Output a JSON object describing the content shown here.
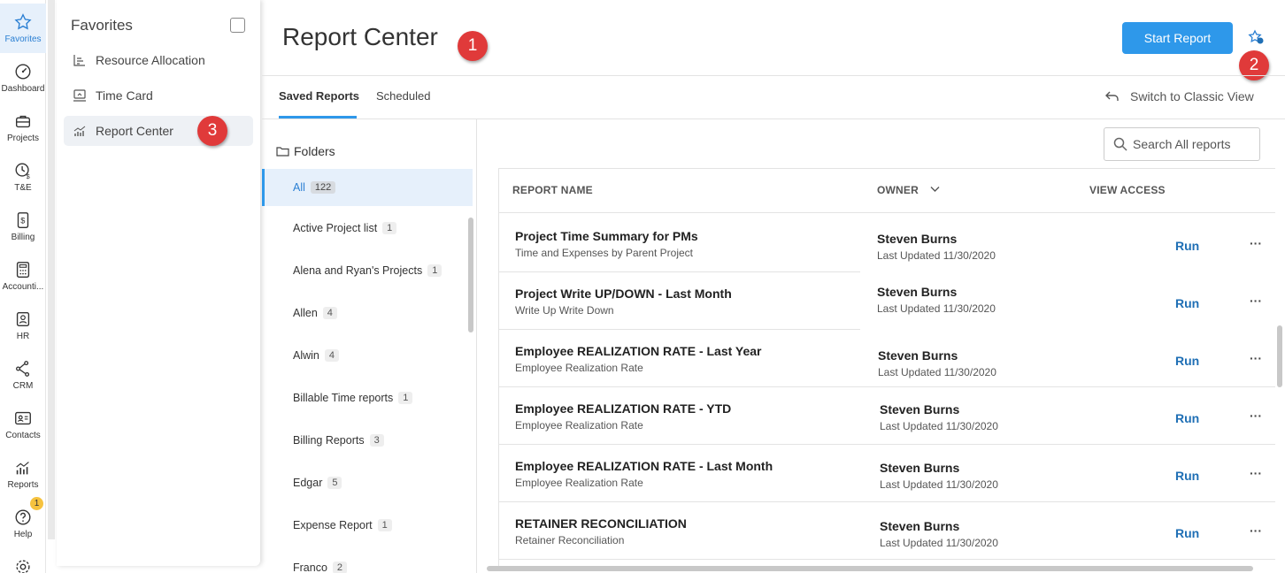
{
  "rail": {
    "items": [
      {
        "label": "Favorites",
        "icon": "star-icon"
      },
      {
        "label": "Dashboard",
        "icon": "dashboard-icon"
      },
      {
        "label": "Projects",
        "icon": "briefcase-icon"
      },
      {
        "label": "T&E",
        "icon": "clock-dollar-icon"
      },
      {
        "label": "Billing",
        "icon": "invoice-dollar-icon"
      },
      {
        "label": "Accounti...",
        "icon": "calculator-icon"
      },
      {
        "label": "HR",
        "icon": "person-badge-icon"
      },
      {
        "label": "CRM",
        "icon": "network-icon"
      },
      {
        "label": "Contacts",
        "icon": "contact-card-icon"
      },
      {
        "label": "Reports",
        "icon": "bar-chart-icon"
      },
      {
        "label": "Help",
        "icon": "help-circle-icon"
      }
    ],
    "help_badge": "1"
  },
  "favorites": {
    "title": "Favorites",
    "items": [
      {
        "label": "Resource Allocation"
      },
      {
        "label": "Time Card"
      },
      {
        "label": "Report Center"
      }
    ]
  },
  "callouts": [
    "1",
    "2",
    "3"
  ],
  "header": {
    "title": "Report Center",
    "start_button": "Start Report"
  },
  "tabs": [
    "Saved Reports",
    "Scheduled"
  ],
  "switch_view": "Switch to Classic View",
  "folders": {
    "heading": "Folders",
    "items": [
      {
        "name": "All",
        "count": "122"
      },
      {
        "name": "Active Project list",
        "count": "1"
      },
      {
        "name": "Alena and Ryan's Projects",
        "count": "1"
      },
      {
        "name": "Allen",
        "count": "4"
      },
      {
        "name": "Alwin",
        "count": "4"
      },
      {
        "name": "Billable Time reports",
        "count": "1"
      },
      {
        "name": "Billing Reports",
        "count": "3"
      },
      {
        "name": "Edgar",
        "count": "5"
      },
      {
        "name": "Expense Report",
        "count": "1"
      },
      {
        "name": "Franco",
        "count": "2"
      }
    ]
  },
  "search": {
    "placeholder": "Search All reports"
  },
  "table": {
    "columns": [
      "REPORT NAME",
      "OWNER",
      "VIEW ACCESS"
    ],
    "run_label": "Run",
    "more_label": "···",
    "rows": [
      {
        "name": "Project Time Summary for PMs",
        "sub": "Time and Expenses by Parent Project",
        "owner": "Steven Burns",
        "updated": "Last Updated 11/30/2020"
      },
      {
        "name": "Project Write UP/DOWN - Last Month",
        "sub": "Write Up Write Down",
        "owner": "Steven Burns",
        "updated": "Last Updated 11/30/2020"
      },
      {
        "name": "Employee REALIZATION RATE - Last Year",
        "sub": "Employee Realization Rate",
        "owner": "Steven Burns",
        "updated": "Last Updated 11/30/2020"
      },
      {
        "name": "Employee REALIZATION RATE - YTD",
        "sub": "Employee Realization Rate",
        "owner": "Steven Burns",
        "updated": "Last Updated 11/30/2020"
      },
      {
        "name": "Employee REALIZATION RATE - Last Month",
        "sub": "Employee Realization Rate",
        "owner": "Steven Burns",
        "updated": "Last Updated 11/30/2020"
      },
      {
        "name": "RETAINER RECONCILIATION",
        "sub": "Retainer Reconciliation",
        "owner": "Steven Burns",
        "updated": "Last Updated 11/30/2020"
      }
    ]
  },
  "colors": {
    "accent": "#2e98ea",
    "callout": "#e03a3a",
    "run_link": "#1f6fb5"
  }
}
